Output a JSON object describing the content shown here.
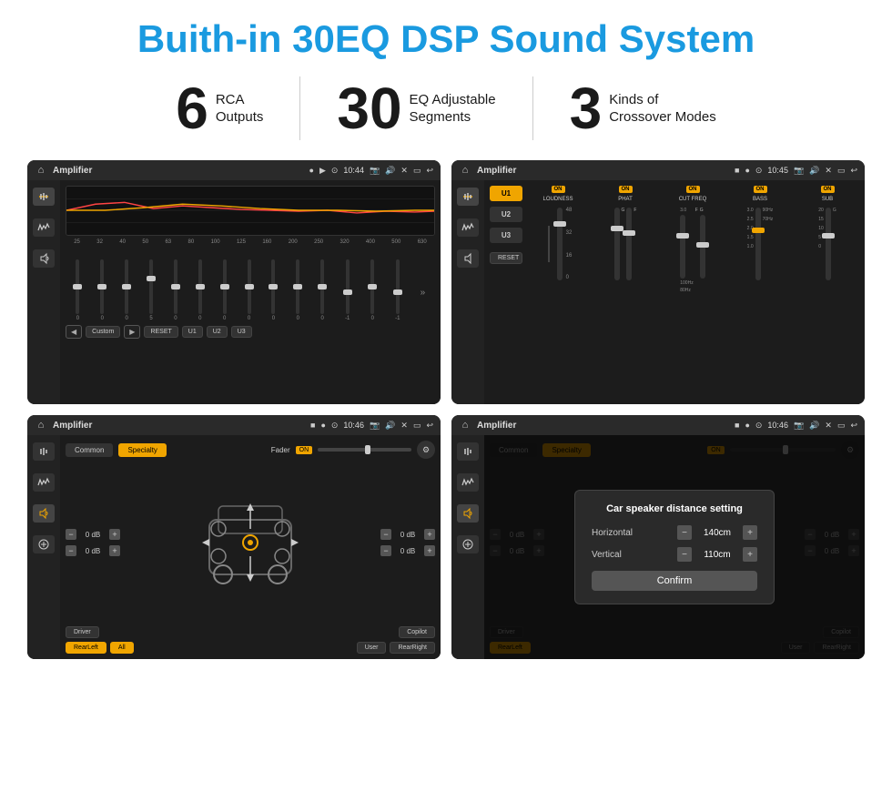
{
  "title": "Buith-in 30EQ DSP Sound System",
  "stats": [
    {
      "number": "6",
      "label_line1": "RCA",
      "label_line2": "Outputs"
    },
    {
      "number": "30",
      "label_line1": "EQ Adjustable",
      "label_line2": "Segments"
    },
    {
      "number": "3",
      "label_line1": "Kinds of",
      "label_line2": "Crossover Modes"
    }
  ],
  "screens": [
    {
      "id": "screen1",
      "topbar": {
        "title": "Amplifier",
        "time": "10:44"
      },
      "type": "eq",
      "freqs": [
        "25",
        "32",
        "40",
        "50",
        "63",
        "80",
        "100",
        "125",
        "160",
        "200",
        "250",
        "320",
        "400",
        "500",
        "630"
      ],
      "values": [
        "0",
        "0",
        "0",
        "5",
        "0",
        "0",
        "0",
        "0",
        "0",
        "0",
        "0",
        "-1",
        "0",
        "-1"
      ],
      "presets": [
        "Custom",
        "RESET",
        "U1",
        "U2",
        "U3"
      ]
    },
    {
      "id": "screen2",
      "topbar": {
        "title": "Amplifier",
        "time": "10:45"
      },
      "type": "amp2",
      "presets": [
        "U1",
        "U2",
        "U3"
      ],
      "channels": [
        {
          "label": "LOUDNESS",
          "on": true
        },
        {
          "label": "PHAT",
          "on": true
        },
        {
          "label": "CUT FREQ",
          "on": true
        },
        {
          "label": "BASS",
          "on": true
        },
        {
          "label": "SUB",
          "on": true
        }
      ]
    },
    {
      "id": "screen3",
      "topbar": {
        "title": "Amplifier",
        "time": "10:46"
      },
      "type": "crossover",
      "tabs": [
        "Common",
        "Specialty"
      ],
      "activeTab": 1,
      "fader": {
        "label": "Fader",
        "on": true
      },
      "db_rows": [
        {
          "value": "0 dB"
        },
        {
          "value": "0 dB"
        },
        {
          "value": "0 dB"
        },
        {
          "value": "0 dB"
        }
      ],
      "bottom_btns": [
        "Driver",
        "All",
        "RearLeft",
        "User",
        "RearRight",
        "Copilot"
      ]
    },
    {
      "id": "screen4",
      "topbar": {
        "title": "Amplifier",
        "time": "10:46"
      },
      "type": "crossover_dialog",
      "tabs": [
        "Common",
        "Specialty"
      ],
      "dialog": {
        "title": "Car speaker distance setting",
        "horizontal_label": "Horizontal",
        "horizontal_value": "140cm",
        "vertical_label": "Vertical",
        "vertical_value": "110cm",
        "confirm_label": "Confirm"
      },
      "db_rows": [
        {
          "value": "0 dB"
        },
        {
          "value": "0 dB"
        }
      ],
      "bottom_btns": [
        "Driver",
        "RearLeft",
        "User",
        "RearRight",
        "Copilot"
      ]
    }
  ]
}
